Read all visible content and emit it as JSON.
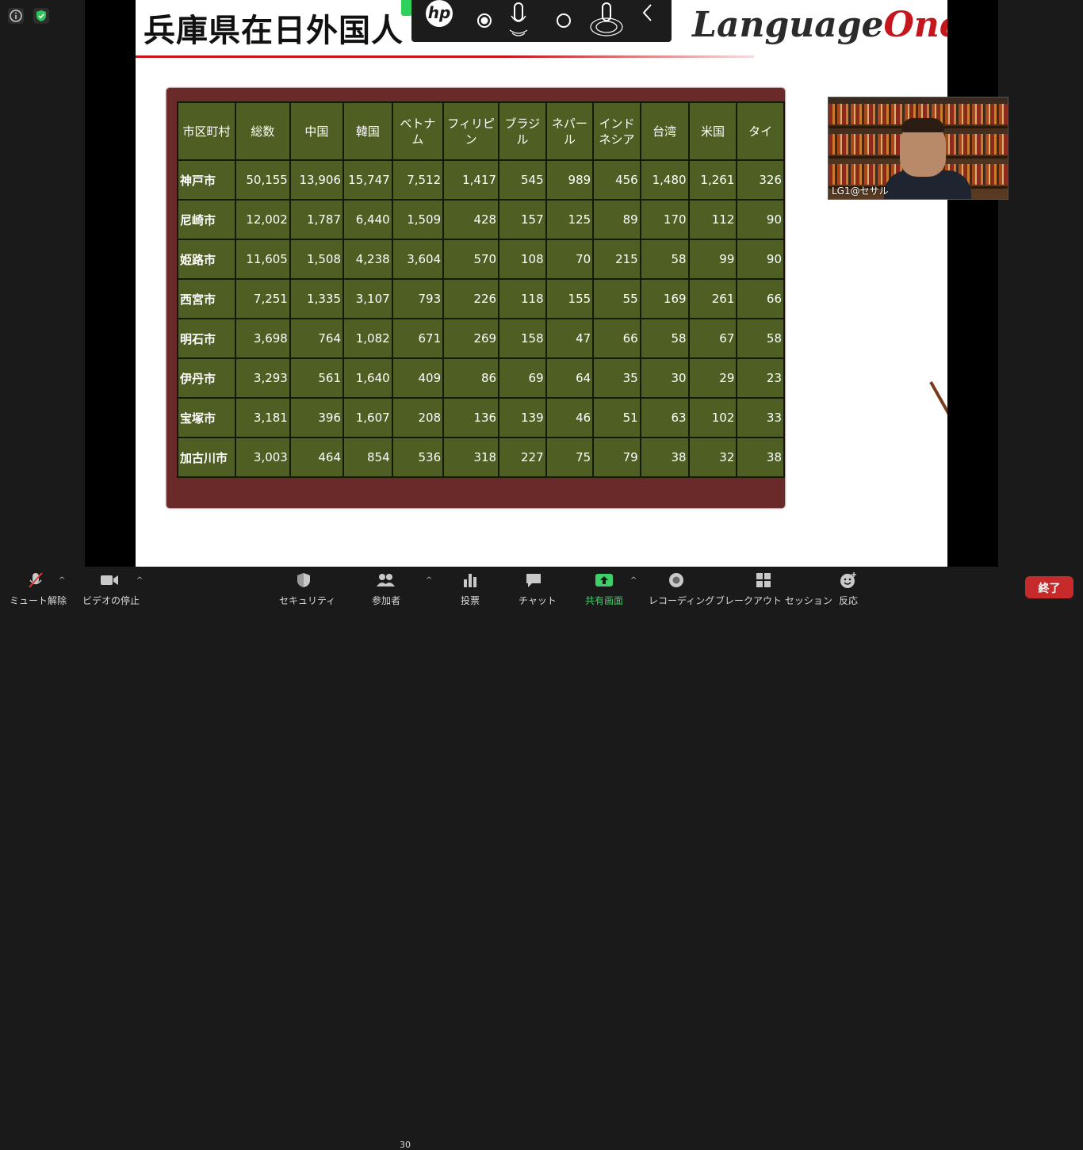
{
  "slide": {
    "title": "兵庫県在日外国人",
    "logo_main": "Language",
    "logo_accent": "One"
  },
  "table": {
    "headers": [
      "市区町村",
      "総数",
      "中国",
      "韓国",
      "ベトナム",
      "フィリピン",
      "ブラジル",
      "ネパール",
      "インドネシア",
      "台湾",
      "米国",
      "タイ"
    ],
    "rows": [
      [
        "神戸市",
        "50,155",
        "13,906",
        "15,747",
        "7,512",
        "1,417",
        "545",
        "989",
        "456",
        "1,480",
        "1,261",
        "326"
      ],
      [
        "尼崎市",
        "12,002",
        "1,787",
        "6,440",
        "1,509",
        "428",
        "157",
        "125",
        "89",
        "170",
        "112",
        "90"
      ],
      [
        "姫路市",
        "11,605",
        "1,508",
        "4,238",
        "3,604",
        "570",
        "108",
        "70",
        "215",
        "58",
        "99",
        "90"
      ],
      [
        "西宮市",
        "7,251",
        "1,335",
        "3,107",
        "793",
        "226",
        "118",
        "155",
        "55",
        "169",
        "261",
        "66"
      ],
      [
        "明石市",
        "3,698",
        "764",
        "1,082",
        "671",
        "269",
        "158",
        "47",
        "66",
        "58",
        "67",
        "58"
      ],
      [
        "伊丹市",
        "3,293",
        "561",
        "1,640",
        "409",
        "86",
        "69",
        "64",
        "35",
        "30",
        "29",
        "23"
      ],
      [
        "宝塚市",
        "3,181",
        "396",
        "1,607",
        "208",
        "136",
        "139",
        "46",
        "51",
        "63",
        "102",
        "33"
      ],
      [
        "加古川市",
        "3,003",
        "464",
        "854",
        "536",
        "318",
        "227",
        "75",
        "79",
        "38",
        "32",
        "38"
      ]
    ]
  },
  "participant": {
    "name": "LG1@セサル"
  },
  "hp_toolbar": {
    "logo": "hp"
  },
  "toolbar": {
    "mute": "ミュート解除",
    "video": "ビデオの停止",
    "security": "セキュリティ",
    "participants": "参加者",
    "participants_count": "30",
    "polls": "投票",
    "chat": "チャット",
    "share": "共有画面",
    "record": "レコーディング",
    "breakout": "ブレークアウト セッション",
    "reactions": "反応",
    "end": "終了"
  },
  "colors": {
    "share_green": "#3ecf6a",
    "end_red": "#c72a2a",
    "board": "#4f5e23"
  }
}
